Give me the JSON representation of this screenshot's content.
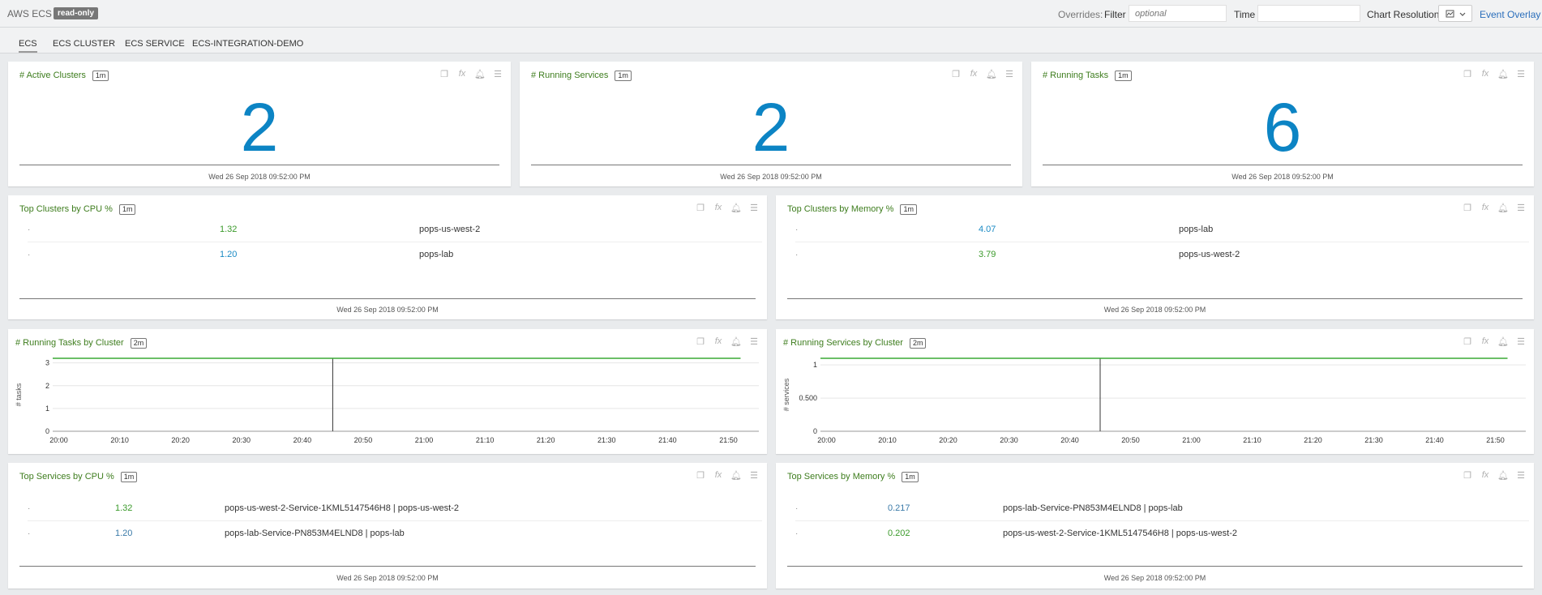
{
  "header": {
    "app_title": "AWS ECS",
    "badge": "read-only",
    "overrides_label": "Overrides:",
    "filter_label": "Filter",
    "filter_placeholder": "optional",
    "time_label": "Time",
    "chart_resolution_label": "Chart Resolution",
    "event_overlay": "Event Overlay"
  },
  "tabs": [
    "ECS",
    "ECS CLUSTER",
    "ECS SERVICE",
    "ECS-INTEGRATION-DEMO"
  ],
  "panels": {
    "active_clusters": {
      "title": "# Active Clusters",
      "res": "1m",
      "value": "2",
      "timestamp": "Wed 26 Sep 2018 09:52:00 PM"
    },
    "running_services": {
      "title": "# Running Services",
      "res": "1m",
      "value": "2",
      "timestamp": "Wed 26 Sep 2018 09:52:00 PM"
    },
    "running_tasks": {
      "title": "# Running Tasks",
      "res": "1m",
      "value": "6",
      "timestamp": "Wed 26 Sep 2018 09:52:00 PM"
    },
    "top_clusters_cpu": {
      "title": "Top Clusters by CPU %",
      "res": "1m",
      "timestamp": "Wed 26 Sep 2018 09:52:00 PM",
      "rows": [
        {
          "value": "1.32",
          "name": "pops-us-west-2",
          "color": "#3a9a2a"
        },
        {
          "value": "1.20",
          "name": "pops-lab",
          "color": "#1a8ac4"
        }
      ]
    },
    "top_clusters_memory": {
      "title": "Top Clusters by Memory %",
      "res": "1m",
      "timestamp": "Wed 26 Sep 2018 09:52:00 PM",
      "rows": [
        {
          "value": "4.07",
          "name": "pops-lab",
          "color": "#1a8ac4"
        },
        {
          "value": "3.79",
          "name": "pops-us-west-2",
          "color": "#3a9a2a"
        }
      ]
    },
    "running_tasks_by_cluster": {
      "title": "# Running Tasks by Cluster",
      "res": "2m",
      "ylabel": "# tasks"
    },
    "running_services_by_cluster": {
      "title": "# Running Services by Cluster",
      "res": "2m",
      "ylabel": "# services"
    },
    "top_services_cpu": {
      "title": "Top Services by CPU %",
      "res": "1m",
      "timestamp": "Wed 26 Sep 2018 09:52:00 PM",
      "rows": [
        {
          "value": "1.32",
          "name": "pops-us-west-2-Service-1KML5147546H8 | pops-us-west-2",
          "color": "#3a9a2a"
        },
        {
          "value": "1.20",
          "name": "pops-lab-Service-PN853M4ELND8 | pops-lab",
          "color": "#3a7aa8"
        }
      ]
    },
    "top_services_memory": {
      "title": "Top Services by Memory %",
      "res": "1m",
      "timestamp": "Wed 26 Sep 2018 09:52:00 PM",
      "rows": [
        {
          "value": "0.217",
          "name": "pops-lab-Service-PN853M4ELND8 | pops-lab",
          "color": "#3a7aa8"
        },
        {
          "value": "0.202",
          "name": "pops-us-west-2-Service-1KML5147546H8 | pops-us-west-2",
          "color": "#3a9a2a"
        }
      ]
    }
  },
  "chart_data": [
    {
      "type": "line",
      "ylabel": "# tasks",
      "x": [
        "20:00",
        "20:10",
        "20:20",
        "20:30",
        "20:40",
        "20:50",
        "21:00",
        "21:10",
        "21:20",
        "21:30",
        "21:40",
        "21:50"
      ],
      "x_range": [
        "19:59",
        "21:55"
      ],
      "ylim": [
        0,
        3.2
      ],
      "yticks": [
        0,
        1,
        2,
        3
      ],
      "series": [
        {
          "start": "19:59",
          "end": "21:52",
          "value": 3.2,
          "color": "#3aaa35"
        }
      ],
      "event_marker": "20:45",
      "grid": true
    },
    {
      "type": "line",
      "ylabel": "# services",
      "x": [
        "20:00",
        "20:10",
        "20:20",
        "20:30",
        "20:40",
        "20:50",
        "21:00",
        "21:10",
        "21:20",
        "21:30",
        "21:40",
        "21:50"
      ],
      "x_range": [
        "19:59",
        "21:55"
      ],
      "ylim": [
        0,
        1.1
      ],
      "yticks": [
        0,
        0.5,
        1
      ],
      "ytick_labels": [
        "0",
        "0.500",
        "1"
      ],
      "series": [
        {
          "start": "19:59",
          "end": "21:52",
          "value": 1.1,
          "color": "#3aaa35"
        }
      ],
      "event_marker": "20:45",
      "grid": true
    }
  ]
}
